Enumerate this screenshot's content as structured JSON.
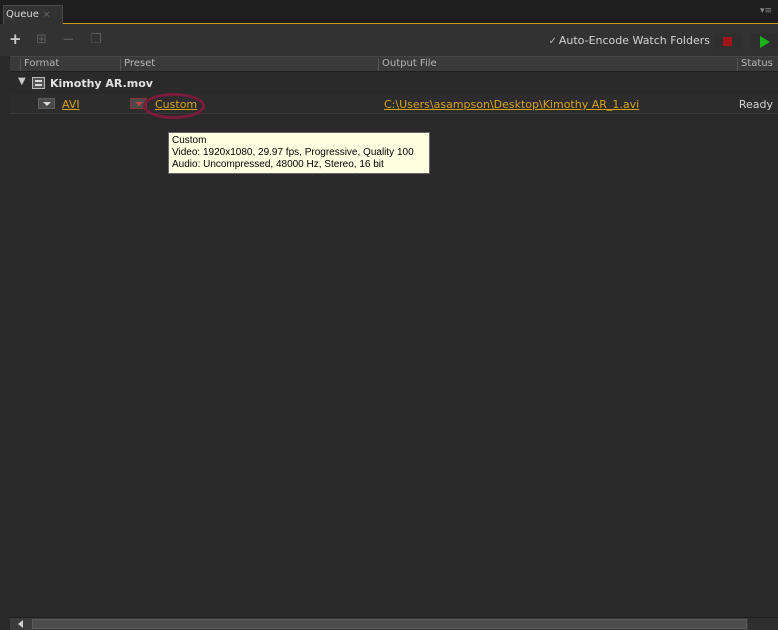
{
  "tab": {
    "label": "Queue",
    "close_glyph": "×",
    "menu_glyph": "▾≡"
  },
  "toolbar": {
    "add_icon": "plus-icon",
    "duplicate_icon": "duplicate-icon",
    "remove_icon": "minus-icon",
    "auto_encode_label": "Auto-Encode Watch Folders",
    "auto_encode_checked": true,
    "stop_color": "#a01616",
    "start_color": "#19b21b"
  },
  "columns": {
    "format": "Format",
    "preset": "Preset",
    "output_file": "Output File",
    "status": "Status"
  },
  "queue": {
    "source_name": "Kimothy AR.mov",
    "output": {
      "format": "AVI",
      "preset": "Custom",
      "output_file": "C:\\Users\\asampson\\Desktop\\Kimothy AR_1.avi",
      "status": "Ready"
    }
  },
  "tooltip": {
    "line1": "Custom",
    "line2": "Video: 1920x1080, 29.97 fps, Progressive, Quality 100",
    "line3": "Audio: Uncompressed, 48000 Hz, Stereo, 16 bit"
  },
  "colors": {
    "link": "#d9a21b",
    "accent": "#c89a1e",
    "highlight_circle": "#7a1b3b"
  }
}
